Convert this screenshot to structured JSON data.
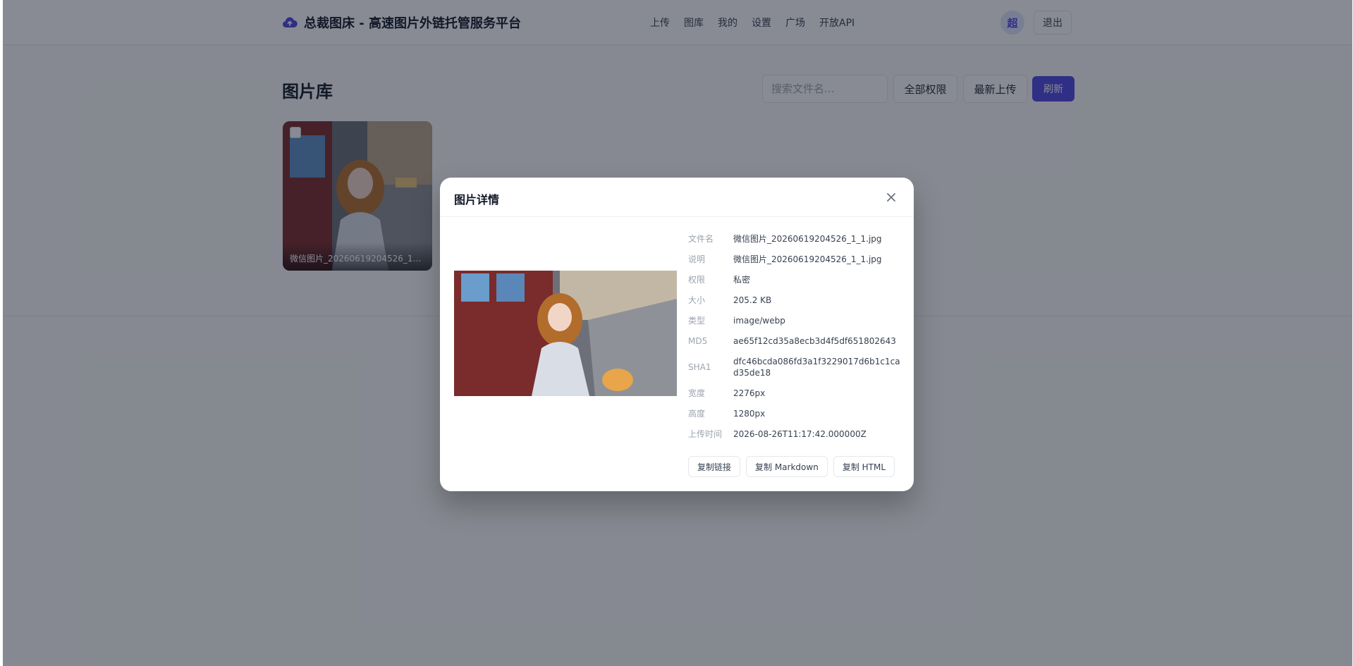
{
  "navbar": {
    "brand": "总裁图床 - 高速图片外链托管服务平台",
    "links": [
      "上传",
      "图库",
      "我的",
      "设置",
      "广场",
      "开放API"
    ],
    "avatar_initial": "超",
    "logout_label": "退出"
  },
  "gallery": {
    "title": "图片库",
    "search_placeholder": "搜索文件名...",
    "permission_filter": "全部权限",
    "sort_option": "最新上传",
    "refresh_label": "刷新",
    "items": [
      {
        "caption": "微信图片_20260619204526_1_1...."
      }
    ]
  },
  "modal": {
    "title": "图片详情",
    "details": [
      {
        "label": "文件名",
        "value": "微信图片_20260619204526_1_1.jpg"
      },
      {
        "label": "说明",
        "value": "微信图片_20260619204526_1_1.jpg"
      },
      {
        "label": "权限",
        "value": "私密"
      },
      {
        "label": "大小",
        "value": "205.2 KB"
      },
      {
        "label": "类型",
        "value": "image/webp"
      },
      {
        "label": "MD5",
        "value": "ae65f12cd35a8ecb3d4f5df651802643"
      },
      {
        "label": "SHA1",
        "value": "dfc46bcda086fd3a1f3229017d6b1c1cad35de18"
      },
      {
        "label": "宽度",
        "value": "2276px"
      },
      {
        "label": "高度",
        "value": "1280px"
      },
      {
        "label": "上传时间",
        "value": "2026-08-26T11:17:42.000000Z"
      }
    ],
    "actions": [
      "复制链接",
      "复制 Markdown",
      "复制 HTML"
    ]
  },
  "colors": {
    "accent": "#4f46e5",
    "overlay": "rgba(17,24,39,0.5)"
  }
}
